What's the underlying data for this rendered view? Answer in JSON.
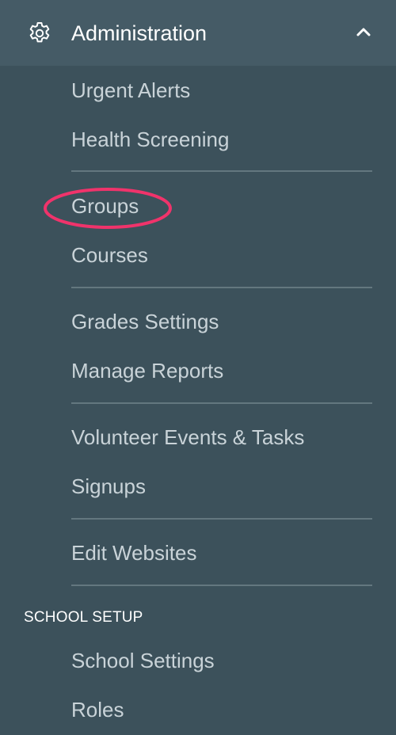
{
  "header": {
    "title": "Administration",
    "icon": "gear-icon",
    "toggle_icon": "chevron-up-icon"
  },
  "menu": {
    "urgent_alerts": "Urgent Alerts",
    "health_screening": "Health Screening",
    "groups": "Groups",
    "courses": "Courses",
    "grades_settings": "Grades Settings",
    "manage_reports": "Manage Reports",
    "volunteer_events": "Volunteer Events & Tasks",
    "signups": "Signups",
    "edit_websites": "Edit Websites"
  },
  "school_setup": {
    "heading": "SCHOOL SETUP",
    "school_settings": "School Settings",
    "roles": "Roles"
  },
  "colors": {
    "background": "#3c515b",
    "header_background": "#455b66",
    "item_text": "#c9d3d8",
    "highlight": "#f0336b"
  }
}
